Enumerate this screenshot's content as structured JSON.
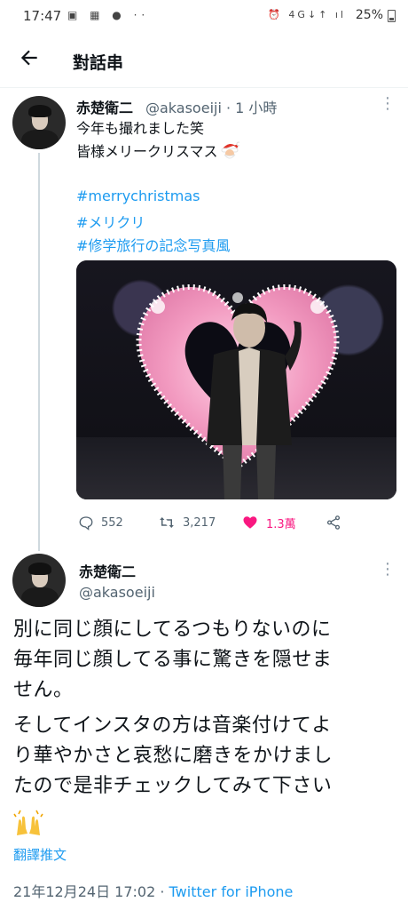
{
  "status_bar": {
    "time": "17:47",
    "left_icons": "▣ ▦ ● ··",
    "right_icons": "⏰ 4G↓↑ ıl",
    "battery": "25%"
  },
  "header": {
    "title": "對話串"
  },
  "reply_tweet": {
    "author_name": "赤楚衛二",
    "author_handle": "@akasoeiji · 1 小時",
    "text_lines": [
      "今年も撮れました笑",
      "皆様メリークリスマス"
    ],
    "hashtags": [
      "#merrychristmas",
      "#メリクリ",
      "#修学旅行の記念写真風"
    ],
    "stats": {
      "replies": "552",
      "retweets": "3,217",
      "likes": "1.3萬"
    }
  },
  "main_tweet": {
    "author_name": "赤楚衛二",
    "author_handle": "@akasoeiji",
    "text_lines": [
      "別に同じ顔にしてるつもりないのに",
      "毎年同じ顔してる事に驚きを隠せま",
      "せん。",
      "そしてインスタの方は音楽付けてよ",
      "り華やかさと哀愁に磨きをかけまし",
      "たので是非チェックしてみて下さい"
    ],
    "translate_label": "翻譯推文",
    "timestamp": "21年12月24日 17:02 · ",
    "source": "Twitter for iPhone"
  },
  "colors": {
    "accent": "#1d9bf0",
    "like": "#f91880",
    "secondary_text": "#536471"
  }
}
